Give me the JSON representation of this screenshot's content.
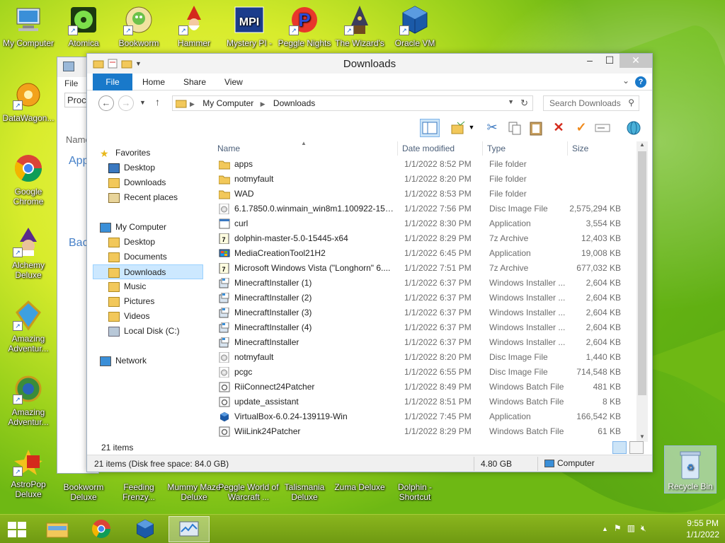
{
  "desktop": {
    "top_icons": [
      {
        "label": "My Computer",
        "icon": "computer-icon"
      },
      {
        "label": "Atomica",
        "icon": "atomica-icon"
      },
      {
        "label": "Bookworm",
        "icon": "bookworm-icon"
      },
      {
        "label": "Hammer",
        "icon": "gnome-icon"
      },
      {
        "label": "Mystery PI -",
        "icon": "mystery-pi-icon"
      },
      {
        "label": "Peggle Nights",
        "icon": "peggle-icon"
      },
      {
        "label": "The Wizard's",
        "icon": "wizard-icon"
      },
      {
        "label": "Oracle VM",
        "icon": "virtualbox-icon"
      }
    ],
    "left_icons": [
      {
        "label": "DataWagon...",
        "icon": "datawagon-icon"
      },
      {
        "label": "Google Chrome",
        "icon": "chrome-icon"
      },
      {
        "label": "Alchemy Deluxe",
        "icon": "alchemy-icon"
      },
      {
        "label": "Amazing Adventur...",
        "icon": "amazing-adventures-icon"
      },
      {
        "label": "Amazing Adventur...",
        "icon": "amazing-adventures-globe-icon"
      },
      {
        "label": "AstroPop Deluxe",
        "icon": "astropop-icon"
      }
    ],
    "bottom_labels": [
      {
        "label": "Bookworm Deluxe"
      },
      {
        "label": "Feeding Frenzy..."
      },
      {
        "label": "Mummy Maze Deluxe"
      },
      {
        "label": "Peggle World of Warcraft ..."
      },
      {
        "label": "Talismania Deluxe"
      },
      {
        "label": "Zuma Deluxe"
      },
      {
        "label": "Dolphin - Shortcut"
      }
    ],
    "recycle_bin": "Recycle Bin"
  },
  "back_window": {
    "tab": "File",
    "row1": "Proce",
    "row2": "Name",
    "apps": "App",
    "bac": "Bac"
  },
  "window": {
    "title": "Downloads",
    "ribbon_tabs": {
      "file": "File",
      "home": "Home",
      "share": "Share",
      "view": "View"
    },
    "help": "?",
    "breadcrumb": [
      "My Computer",
      "Downloads"
    ],
    "search_placeholder": "Search Downloads",
    "columns": {
      "name": "Name",
      "date": "Date modified",
      "type": "Type",
      "size": "Size"
    },
    "nav": {
      "favorites": "Favorites",
      "desktop": "Desktop",
      "downloads": "Downloads",
      "recent": "Recent places",
      "my_computer": "My Computer",
      "mc_desktop": "Desktop",
      "documents": "Documents",
      "mc_downloads": "Downloads",
      "music": "Music",
      "pictures": "Pictures",
      "videos": "Videos",
      "local_disk": "Local Disk (C:)",
      "network": "Network"
    },
    "files": [
      {
        "name": "apps",
        "date": "1/1/2022 8:52 PM",
        "type": "File folder",
        "size": "",
        "icon": "folder-icon"
      },
      {
        "name": "notmyfault",
        "date": "1/1/2022 8:20 PM",
        "type": "File folder",
        "size": "",
        "icon": "folder-icon"
      },
      {
        "name": "WAD",
        "date": "1/1/2022 8:53 PM",
        "type": "File folder",
        "size": "",
        "icon": "folder-icon"
      },
      {
        "name": "6.1.7850.0.winmain_win8m1.100922-1508...",
        "date": "1/1/2022 7:56 PM",
        "type": "Disc Image File",
        "size": "2,575,294 KB",
        "icon": "disc-icon"
      },
      {
        "name": "curl",
        "date": "1/1/2022 8:30 PM",
        "type": "Application",
        "size": "3,554 KB",
        "icon": "app-icon"
      },
      {
        "name": "dolphin-master-5.0-15445-x64",
        "date": "1/1/2022 8:29 PM",
        "type": "7z Archive",
        "size": "12,403 KB",
        "icon": "archive-icon"
      },
      {
        "name": "MediaCreationTool21H2",
        "date": "1/1/2022 6:45 PM",
        "type": "Application",
        "size": "19,008 KB",
        "icon": "mediacreation-icon"
      },
      {
        "name": "Microsoft Windows Vista (\"Longhorn\" 6....",
        "date": "1/1/2022 7:51 PM",
        "type": "7z Archive",
        "size": "677,032 KB",
        "icon": "archive-icon"
      },
      {
        "name": "MinecraftInstaller (1)",
        "date": "1/1/2022 6:37 PM",
        "type": "Windows Installer ...",
        "size": "2,604 KB",
        "icon": "installer-icon"
      },
      {
        "name": "MinecraftInstaller (2)",
        "date": "1/1/2022 6:37 PM",
        "type": "Windows Installer ...",
        "size": "2,604 KB",
        "icon": "installer-icon"
      },
      {
        "name": "MinecraftInstaller (3)",
        "date": "1/1/2022 6:37 PM",
        "type": "Windows Installer ...",
        "size": "2,604 KB",
        "icon": "installer-icon"
      },
      {
        "name": "MinecraftInstaller (4)",
        "date": "1/1/2022 6:37 PM",
        "type": "Windows Installer ...",
        "size": "2,604 KB",
        "icon": "installer-icon"
      },
      {
        "name": "MinecraftInstaller",
        "date": "1/1/2022 6:37 PM",
        "type": "Windows Installer ...",
        "size": "2,604 KB",
        "icon": "installer-icon"
      },
      {
        "name": "notmyfault",
        "date": "1/1/2022 8:20 PM",
        "type": "Disc Image File",
        "size": "1,440 KB",
        "icon": "disc-icon"
      },
      {
        "name": "pcgc",
        "date": "1/1/2022 6:55 PM",
        "type": "Disc Image File",
        "size": "714,548 KB",
        "icon": "disc-icon"
      },
      {
        "name": "RiiConnect24Patcher",
        "date": "1/1/2022 8:49 PM",
        "type": "Windows Batch File",
        "size": "481 KB",
        "icon": "batch-icon"
      },
      {
        "name": "update_assistant",
        "date": "1/1/2022 8:51 PM",
        "type": "Windows Batch File",
        "size": "8 KB",
        "icon": "batch-icon"
      },
      {
        "name": "VirtualBox-6.0.24-139119-Win",
        "date": "1/1/2022 7:45 PM",
        "type": "Application",
        "size": "166,542 KB",
        "icon": "virtualbox-icon"
      },
      {
        "name": "WiiLink24Patcher",
        "date": "1/1/2022 8:29 PM",
        "type": "Windows Batch File",
        "size": "61 KB",
        "icon": "batch-icon"
      }
    ],
    "item_count": "21 items",
    "status_left": "21 items (Disk free space: 84.0 GB)",
    "status_size": "4.80 GB",
    "status_location": "Computer"
  },
  "taskbar": {
    "apps": [
      {
        "name": "file-explorer",
        "icon": "folder-icon",
        "active": false
      },
      {
        "name": "chrome",
        "icon": "chrome-icon",
        "active": false
      },
      {
        "name": "virtualbox",
        "icon": "virtualbox-icon",
        "active": false
      },
      {
        "name": "task-manager",
        "icon": "taskmgr-icon",
        "active": true
      }
    ],
    "time": "9:55 PM",
    "date": "1/1/2022"
  },
  "colors": {
    "accent": "#1979ca",
    "selection": "#cce8ff",
    "muted_text": "#6d6d6d"
  }
}
